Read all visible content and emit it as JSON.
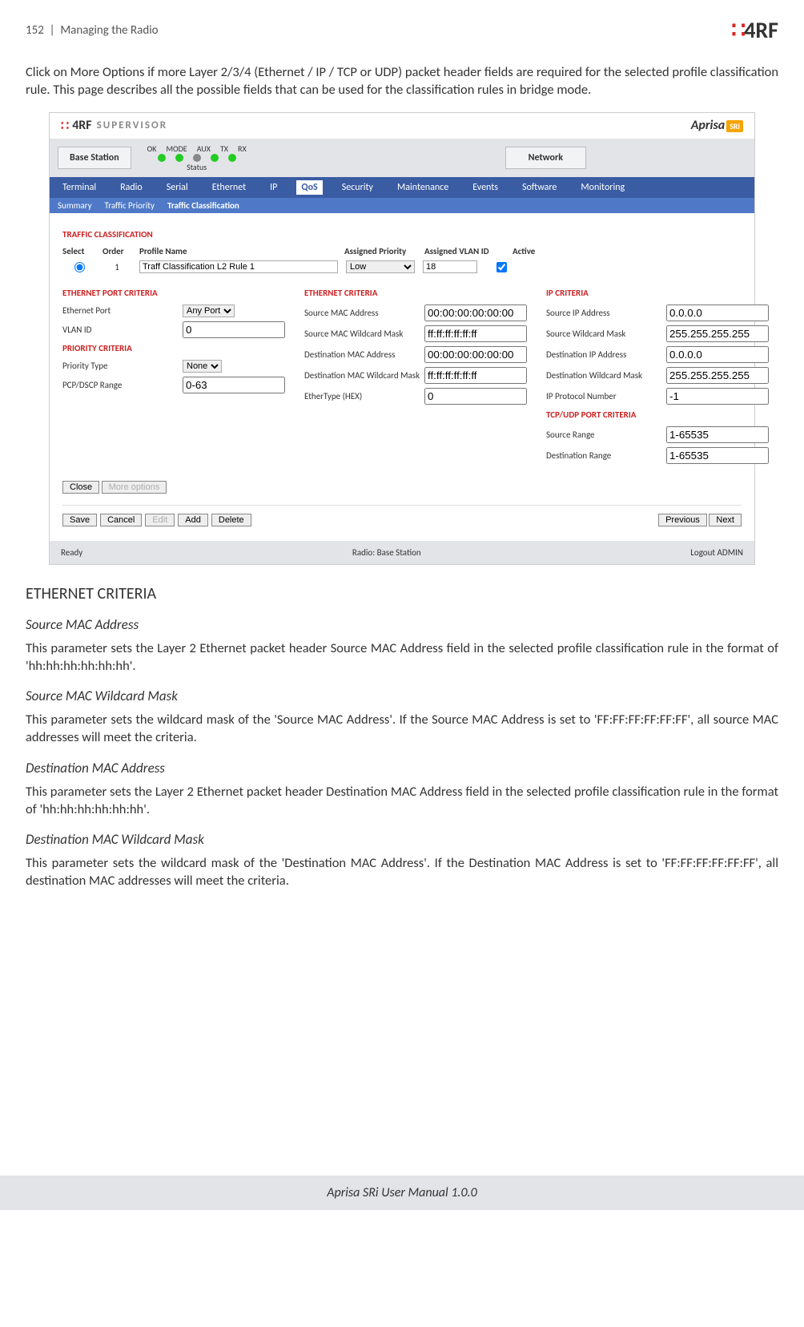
{
  "header": {
    "page_num": "152",
    "section": "Managing the Radio",
    "logo_text": "4RF"
  },
  "intro": "Click on More Options if more Layer 2/3/4 (Ethernet / IP / TCP or UDP) packet header fields are required for the selected profile classification rule. This page describes all the possible fields that can be used for the classification rules in bridge mode.",
  "screenshot": {
    "brand_super": "SUPERVISOR",
    "brand_rf": "4RF",
    "aprisa": "Aprisa",
    "aprisa_badge": "SRi",
    "status": {
      "base": "Base Station",
      "labels": [
        "OK",
        "MODE",
        "AUX",
        "TX",
        "RX"
      ],
      "status_label": "Status",
      "network": "Network"
    },
    "nav": [
      "Terminal",
      "Radio",
      "Serial",
      "Ethernet",
      "IP",
      "QoS",
      "Security",
      "Maintenance",
      "Events",
      "Software",
      "Monitoring"
    ],
    "nav_active": "QoS",
    "subnav": [
      "Summary",
      "Traffic Priority",
      "Traffic Classification"
    ],
    "subnav_active": "Traffic Classification",
    "sec_traffic": "TRAFFIC CLASSIFICATION",
    "th": {
      "select": "Select",
      "order": "Order",
      "profile": "Profile Name",
      "priority": "Assigned Priority",
      "vlan": "Assigned VLAN ID",
      "active": "Active"
    },
    "row1": {
      "order": "1",
      "profile": "Traff Classification L2 Rule 1",
      "priority": "Low",
      "vlan": "18",
      "active": true
    },
    "sec_eth_port": "ETHERNET PORT CRITERIA",
    "eth_port_lbl": "Ethernet Port",
    "eth_port_val": "Any Port",
    "vlan_id_lbl": "VLAN ID",
    "vlan_id_val": "0",
    "sec_priority": "PRIORITY CRITERIA",
    "prio_type_lbl": "Priority Type",
    "prio_type_val": "None",
    "pcp_lbl": "PCP/DSCP Range",
    "pcp_val": "0-63",
    "sec_eth": "ETHERNET CRITERIA",
    "src_mac_lbl": "Source MAC Address",
    "src_mac_val": "00:00:00:00:00:00",
    "src_mac_wm_lbl": "Source MAC Wildcard Mask",
    "src_mac_wm_val": "ff:ff:ff:ff:ff:ff",
    "dst_mac_lbl": "Destination MAC Address",
    "dst_mac_val": "00:00:00:00:00:00",
    "dst_mac_wm_lbl": "Destination MAC Wildcard Mask",
    "dst_mac_wm_val": "ff:ff:ff:ff:ff:ff",
    "ethertype_lbl": "EtherType (HEX)",
    "ethertype_val": "0",
    "sec_ip": "IP CRITERIA",
    "src_ip_lbl": "Source IP Address",
    "src_ip_val": "0.0.0.0",
    "src_wm_lbl": "Source Wildcard Mask",
    "src_wm_val": "255.255.255.255",
    "dst_ip_lbl": "Destination IP Address",
    "dst_ip_val": "0.0.0.0",
    "dst_wm_lbl": "Destination Wildcard Mask",
    "dst_wm_val": "255.255.255.255",
    "proto_lbl": "IP Protocol Number",
    "proto_val": "-1",
    "sec_tcp": "TCP/UDP PORT CRITERIA",
    "src_range_lbl": "Source Range",
    "src_range_val": "1-65535",
    "dst_range_lbl": "Destination Range",
    "dst_range_val": "1-65535",
    "btn_close": "Close",
    "btn_more": "More options",
    "btn_save": "Save",
    "btn_cancel": "Cancel",
    "btn_edit": "Edit",
    "btn_add": "Add",
    "btn_delete": "Delete",
    "btn_prev": "Previous",
    "btn_next": "Next",
    "footer_ready": "Ready",
    "footer_radio": "Radio: Base Station",
    "footer_logout": "Logout ADMIN"
  },
  "sections": {
    "eth_criteria": "ETHERNET CRITERIA",
    "src_mac_h": "Source MAC Address",
    "src_mac_p": "This parameter sets the Layer 2 Ethernet packet header Source MAC Address field in the selected profile classification rule in the format of 'hh:hh:hh:hh:hh:hh'.",
    "src_mac_wm_h": "Source MAC Wildcard Mask",
    "src_mac_wm_p": "This parameter sets the wildcard mask of the 'Source MAC Address'. If the Source MAC Address is set to 'FF:FF:FF:FF:FF:FF', all source MAC addresses will meet the criteria.",
    "dst_mac_h": "Destination MAC Address",
    "dst_mac_p": "This parameter sets the Layer 2 Ethernet packet header Destination MAC Address field in the selected profile classification rule in the format of 'hh:hh:hh:hh:hh:hh'.",
    "dst_mac_wm_h": "Destination MAC Wildcard Mask",
    "dst_mac_wm_p": "This parameter sets the wildcard mask of the 'Destination MAC Address'. If the Destination MAC Address is set to 'FF:FF:FF:FF:FF:FF', all destination MAC addresses will meet the criteria."
  },
  "footer": "Aprisa SRi User Manual 1.0.0"
}
